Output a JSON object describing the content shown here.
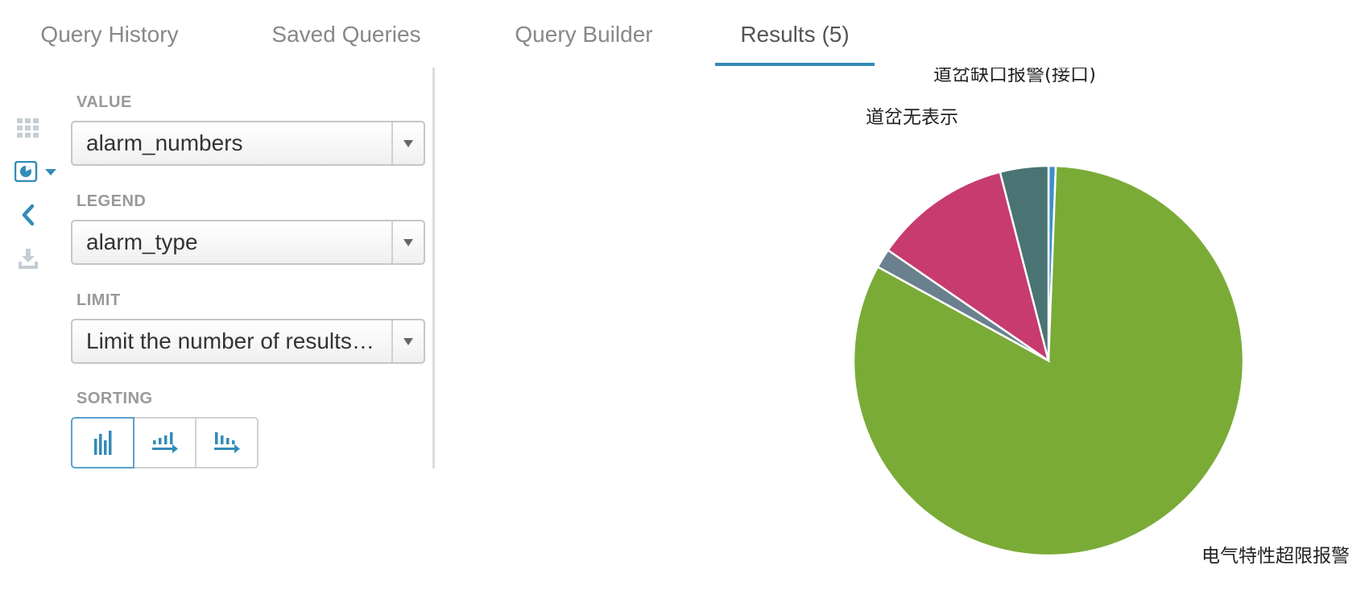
{
  "tabs": [
    {
      "label": "Query History",
      "active": false
    },
    {
      "label": "Saved Queries",
      "active": false
    },
    {
      "label": "Query Builder",
      "active": false
    },
    {
      "label": "Results (5)",
      "active": true
    }
  ],
  "rail": {
    "icons": [
      "grid-icon",
      "pie-chart-icon",
      "chevron-left-icon",
      "download-icon"
    ],
    "accent": "#338bb8"
  },
  "settings": {
    "value": {
      "label": "VALUE",
      "selected": "alarm_numbers"
    },
    "legend": {
      "label": "LEGEND",
      "selected": "alarm_type"
    },
    "limit": {
      "label": "LIMIT",
      "selected": "Limit the number of results…"
    },
    "sorting": {
      "label": "SORTING",
      "options": [
        "sort-none-icon",
        "sort-ascending-icon",
        "sort-descending-icon"
      ],
      "selected": 0
    }
  },
  "chart_data": {
    "type": "pie",
    "title": "",
    "slices": [
      {
        "label": "",
        "value": 0.6,
        "color": "#3e8fc9"
      },
      {
        "label": "电气特性超限报警",
        "value": 82.4,
        "color": "#7aab37"
      },
      {
        "label": "",
        "value": 1.6,
        "color": "#6a808e"
      },
      {
        "label": "道岔无表示",
        "value": 11.4,
        "color": "#c73b6e"
      },
      {
        "label": "道岔缺口报警(接口)",
        "value": 4.0,
        "color": "#4a7373"
      }
    ]
  }
}
